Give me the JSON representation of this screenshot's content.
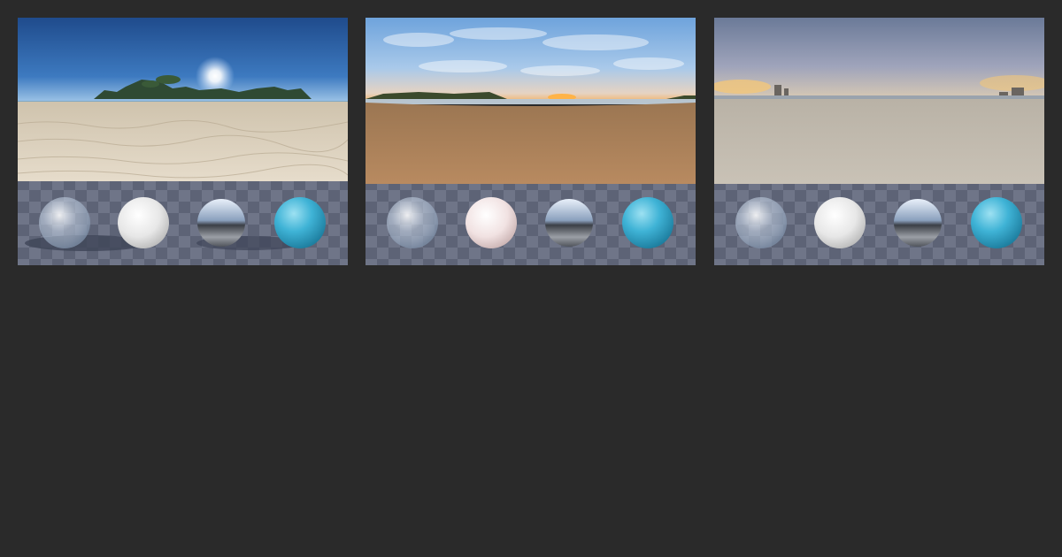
{
  "gallery": {
    "items": [
      {
        "preview": "beach-sunny-day-hdri-preview",
        "spheres": [
          "glass-sphere-icon",
          "matte-white-sphere-icon",
          "chrome-sphere-icon",
          "glossy-blue-sphere-icon"
        ]
      },
      {
        "preview": "beach-sunset-hdri-preview",
        "spheres": [
          "glass-sphere-icon",
          "matte-white-sphere-icon",
          "chrome-sphere-icon",
          "glossy-blue-sphere-icon"
        ]
      },
      {
        "preview": "overcast-beach-dusk-hdri-preview",
        "spheres": [
          "glass-sphere-icon",
          "matte-white-sphere-icon",
          "chrome-sphere-icon",
          "glossy-blue-sphere-icon"
        ]
      }
    ]
  },
  "colors": {
    "background": "#2a2a2a",
    "checker_light": "#6f7588",
    "checker_dark": "#5d6376",
    "sphere_blue": "#3fb3d6",
    "sphere_white": "#ededed"
  }
}
